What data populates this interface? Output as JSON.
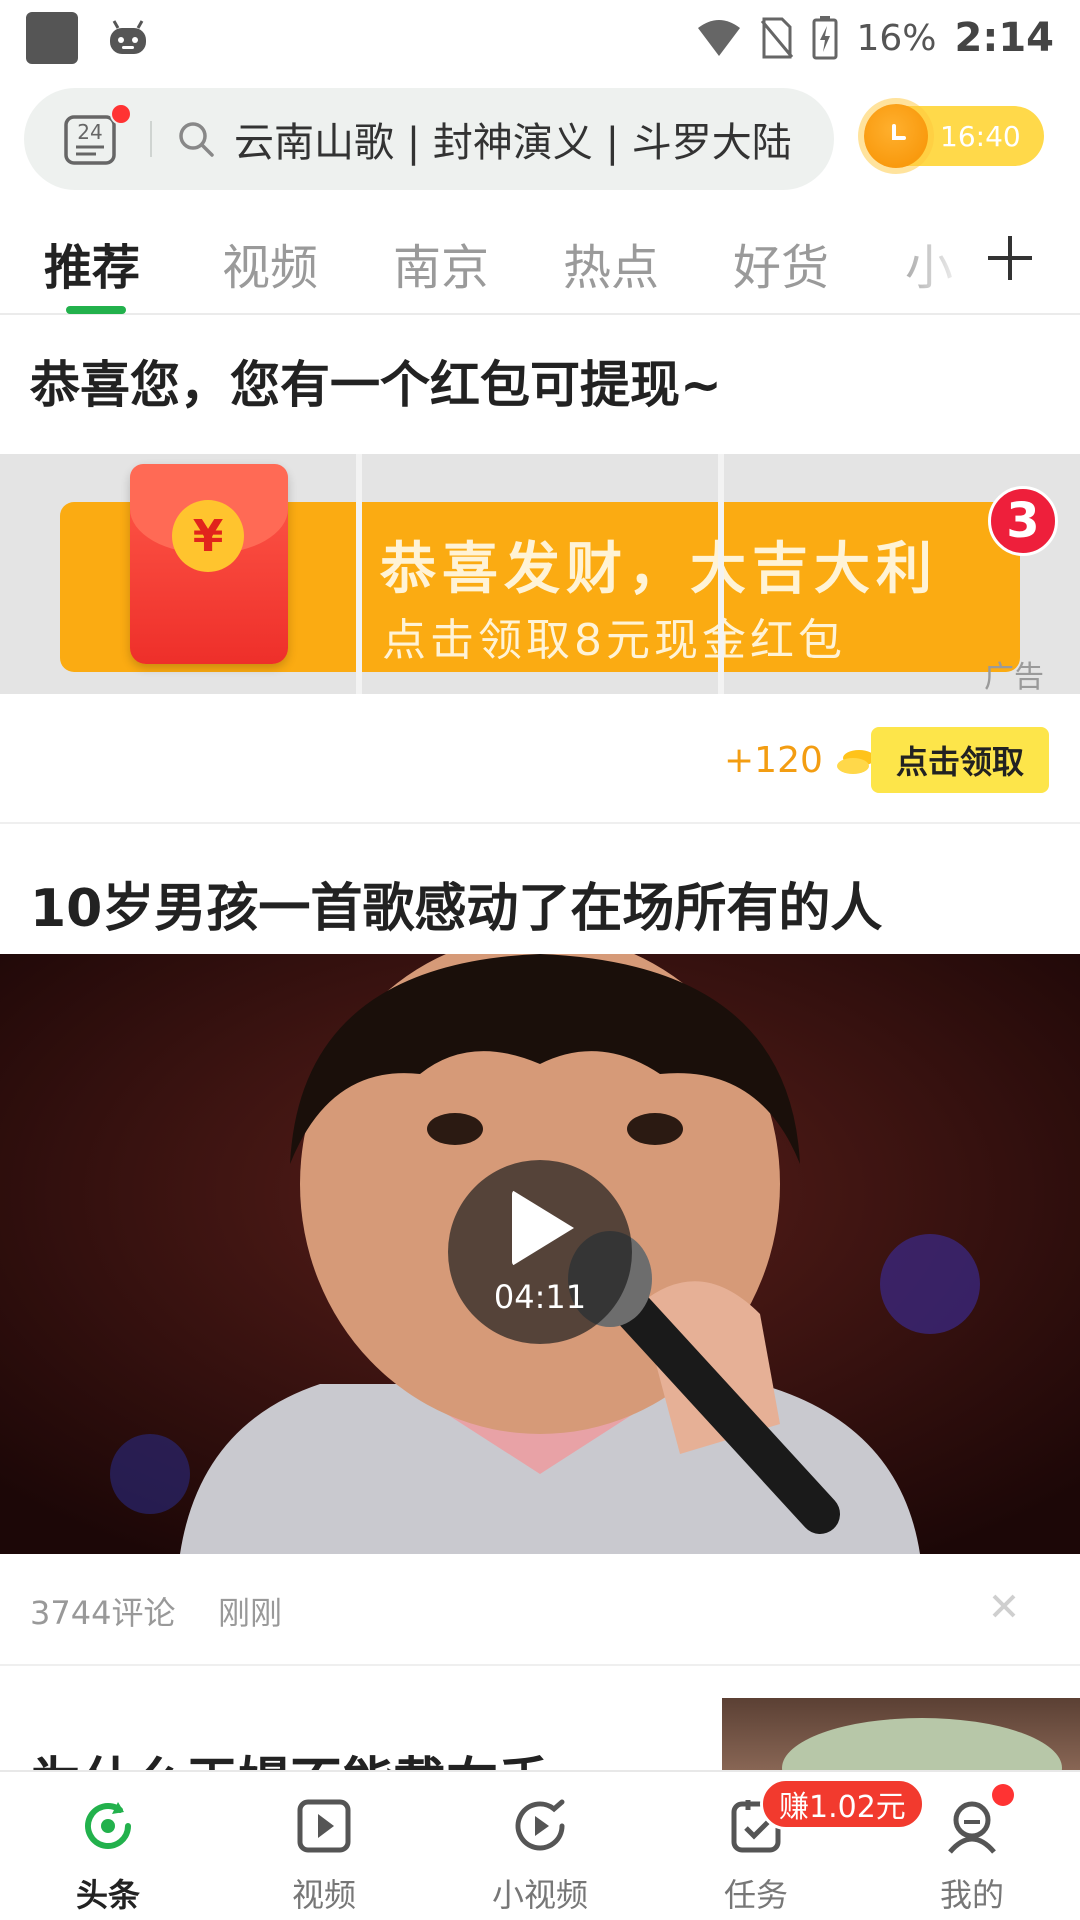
{
  "status_bar": {
    "battery_percent": "16%",
    "time": "2:14"
  },
  "header": {
    "calendar_day": "24",
    "search_placeholder": "云南山歌 | 封神演义 | 斗罗大陆",
    "timer_value": "16:40"
  },
  "tabs": {
    "items": [
      {
        "label": "推荐",
        "active": true
      },
      {
        "label": "视频",
        "active": false
      },
      {
        "label": "南京",
        "active": false
      },
      {
        "label": "热点",
        "active": false
      },
      {
        "label": "好货",
        "active": false
      },
      {
        "label": "小",
        "active": false
      }
    ]
  },
  "ad_card": {
    "title": "恭喜您，您有一个红包可提现~",
    "yen_symbol": "¥",
    "headline": "恭喜发财，大吉大利",
    "subline": "点击领取8元现金红包",
    "count_badge": "3",
    "ad_label": "广告",
    "reward_text": "+120",
    "claim_button": "点击领取"
  },
  "article": {
    "title": "10岁男孩一首歌感动了在场所有的人",
    "video_duration": "04:11",
    "comments": "3744评论",
    "time_ago": "刚刚"
  },
  "next_article": {
    "title_partial": "为什么王嫚不能戴右手"
  },
  "bottom_nav": {
    "items": [
      {
        "label": "头条",
        "icon": "refresh-circle-icon",
        "active": true
      },
      {
        "label": "视频",
        "icon": "video-play-icon",
        "active": false
      },
      {
        "label": "小视频",
        "icon": "small-video-icon",
        "active": false
      },
      {
        "label": "任务",
        "icon": "task-clipboard-icon",
        "active": false
      },
      {
        "label": "我的",
        "icon": "profile-icon",
        "active": false
      }
    ],
    "earn_badge": "赚1.02元"
  },
  "colors": {
    "accent_green": "#22b14c",
    "badge_yellow": "#fde54a",
    "ad_orange": "#fbab12",
    "alert_red": "#f23a2e"
  }
}
